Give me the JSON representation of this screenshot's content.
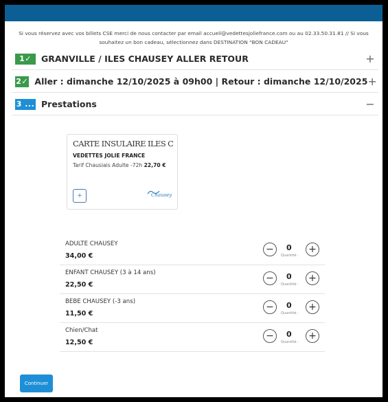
{
  "notice": "Si vous réservez avec vos billets CSE merci de nous contacter par email accueil@vedettesjoliefrance.com ou au 02.33.50.31.81 // Si vous souhaitez un bon cadeau, sélectionnez dans DESTINATION \"BON CADEAU\"",
  "steps": [
    {
      "badge": "1✓",
      "title": "GRANVILLE / ILES CHAUSEY ALLER RETOUR",
      "toggle": "+"
    },
    {
      "badge": "2✓",
      "title": "Aller : dimanche 12/10/2025 à 09h00 | Retour : dimanche 12/10/2025",
      "toggle": "+"
    },
    {
      "badge": "3 ...",
      "title": "Prestations",
      "toggle": "−"
    }
  ],
  "card": {
    "title": "CARTE INSULAIRE ILES CHAUSEY",
    "company": "VEDETTES JOLIE FRANCE",
    "tariff_label": "Tarif Chausiais Adulte -72h ",
    "tariff_price": "22,70 €",
    "add_glyph": "+",
    "logo_text": "Chausey"
  },
  "products": [
    {
      "name": "ADULTE CHAUSEY",
      "price": "34,00 €",
      "qty": "0",
      "qty_label": "Quantité :"
    },
    {
      "name": "ENFANT CHAUSEY (3 à 14 ans)",
      "price": "22,50 €",
      "qty": "0",
      "qty_label": "Quantité :"
    },
    {
      "name": "BEBE CHAUSEY (-3 ans)",
      "price": "11,50 €",
      "qty": "0",
      "qty_label": "Quantité :"
    },
    {
      "name": "Chien/Chat",
      "price": "12,50 €",
      "qty": "0",
      "qty_label": "Quantité :"
    }
  ],
  "qty_controls": {
    "minus": "−",
    "plus": "+"
  },
  "continue_label": "Continuer",
  "colors": {
    "header": "#0b5f95",
    "done": "#3a9a4b",
    "active": "#1e8fd6"
  }
}
